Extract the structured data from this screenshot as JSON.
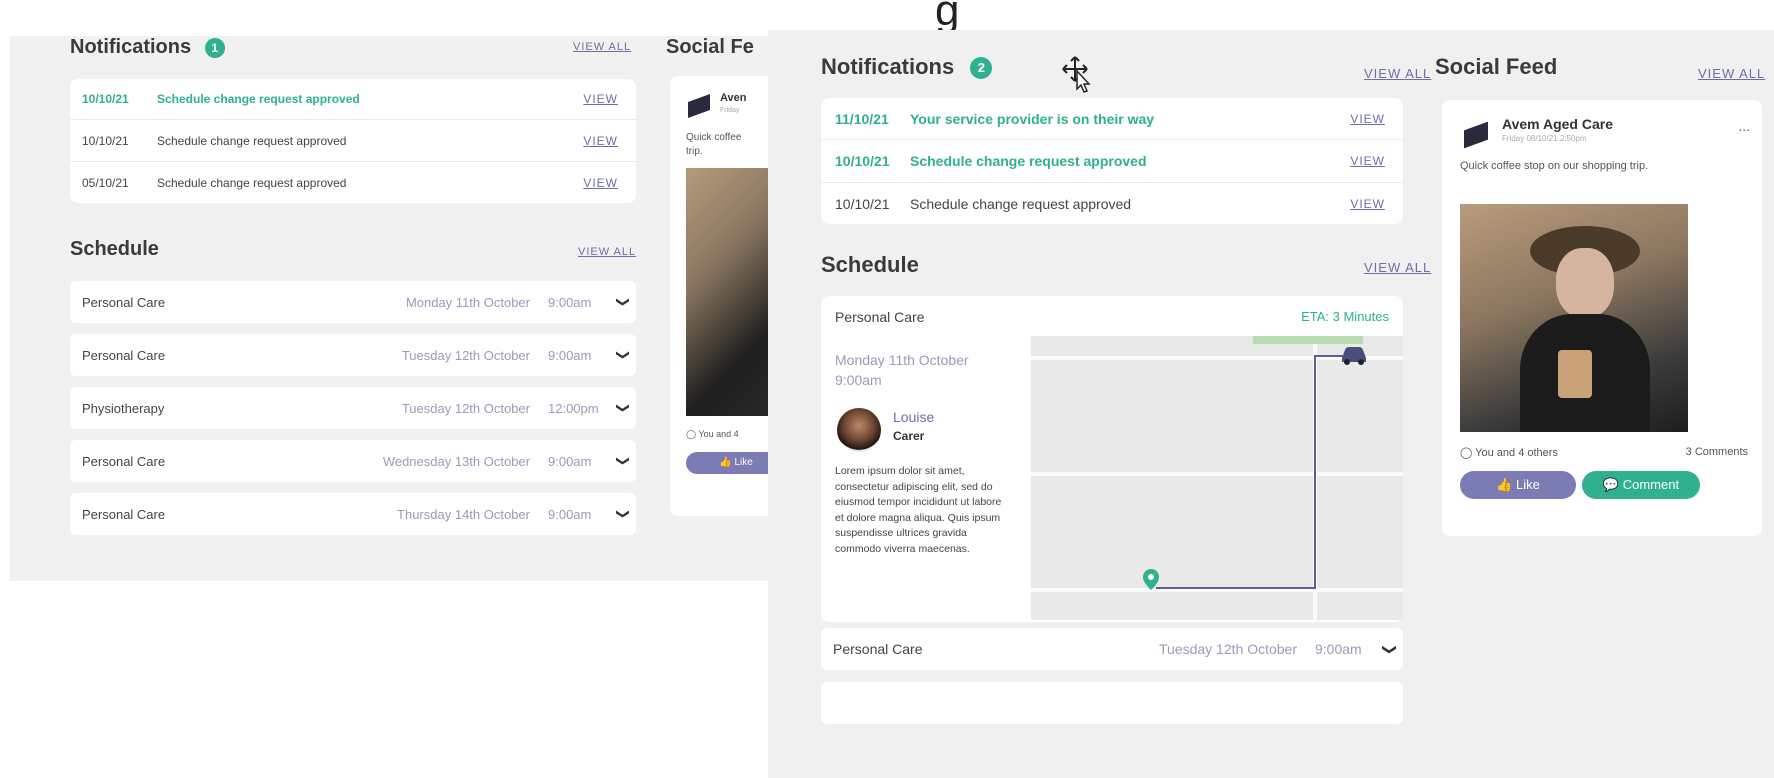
{
  "top_banner_fragment": "g",
  "back": {
    "notifications": {
      "title": "Notifications",
      "count": "1",
      "view_all": "VIEW ALL",
      "rows": [
        {
          "date": "10/10/21",
          "message": "Schedule change request approved",
          "view": "VIEW",
          "highlight": true
        },
        {
          "date": "10/10/21",
          "message": "Schedule change request approved",
          "view": "VIEW",
          "highlight": false
        },
        {
          "date": "05/10/21",
          "message": "Schedule change request approved",
          "view": "VIEW",
          "highlight": false
        }
      ]
    },
    "schedule": {
      "title": "Schedule",
      "view_all": "VIEW ALL",
      "rows": [
        {
          "type": "Personal Care",
          "date": "Monday 11th October",
          "time": "9:00am"
        },
        {
          "type": "Personal Care",
          "date": "Tuesday 12th October",
          "time": "9:00am"
        },
        {
          "type": "Physiotherapy",
          "date": "Tuesday 12th October",
          "time": "12:00pm"
        },
        {
          "type": "Personal Care",
          "date": "Wednesday 13th October",
          "time": "9:00am"
        },
        {
          "type": "Personal Care",
          "date": "Thursday 14th October",
          "time": "9:00am"
        }
      ]
    },
    "social": {
      "title": "Social Fe",
      "author": "Aven",
      "timestamp": "Friday",
      "text": "Quick coffee",
      "text2": "trip.",
      "likes": "You and 4",
      "like_button": "Like"
    }
  },
  "front": {
    "notifications": {
      "title": "Notifications",
      "count": "2",
      "view_all": "VIEW ALL",
      "rows": [
        {
          "date": "11/10/21",
          "message": "Your service provider is on their way",
          "view": "VIEW",
          "highlight": true
        },
        {
          "date": "10/10/21",
          "message": "Schedule change request approved",
          "view": "VIEW",
          "highlight": true
        },
        {
          "date": "10/10/21",
          "message": "Schedule change request approved",
          "view": "VIEW",
          "highlight": false
        }
      ]
    },
    "schedule": {
      "title": "Schedule",
      "view_all": "VIEW ALL",
      "expanded": {
        "type": "Personal Care",
        "eta": "ETA: 3 Minutes",
        "date": "Monday 11th October",
        "time": "9:00am",
        "carer_name": "Louise",
        "carer_role": "Carer",
        "description": "Lorem ipsum dolor sit amet, consectetur adipiscing elit, sed do eiusmod tempor incididunt ut labore et dolore magna aliqua. Quis ipsum suspendisse ultrices gravida commodo viverra maecenas."
      },
      "rows": [
        {
          "type": "Personal Care",
          "date": "Tuesday 12th October",
          "time": "9:00am"
        }
      ]
    },
    "social": {
      "title": "Social Feed",
      "view_all": "VIEW ALL",
      "author": "Avem Aged Care",
      "timestamp": "Friday 08/10/21 2:50pm",
      "text": "Quick coffee stop on our shopping trip.",
      "likes": "You and 4 others",
      "comments": "3 Comments",
      "like_button": "Like",
      "comment_button": "Comment",
      "more": "..."
    }
  },
  "colors": {
    "accent_green": "#2fb08e",
    "accent_purple": "#6d6ea6",
    "panel_bg": "#f1f1f1"
  }
}
